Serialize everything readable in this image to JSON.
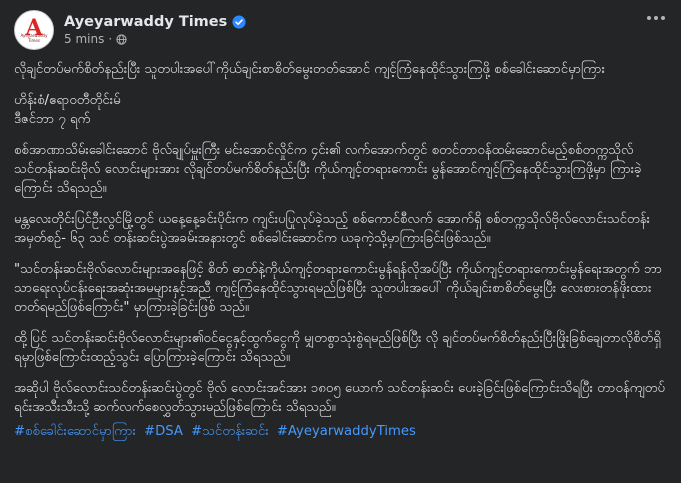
{
  "post": {
    "author": "Ayeyarwaddy Times",
    "time": "5 mins",
    "separator": "·",
    "avatar_logo": "A",
    "avatar_text": "Ayeyarwaddy Times",
    "icons": {
      "verified": "verified-badge-icon",
      "privacy": "globe-icon",
      "more": "more-options-icon"
    },
    "colors": {
      "background": "#242526",
      "text": "#e4e6eb",
      "secondary": "#b0b3b8",
      "link": "#4599ff",
      "verified": "#2d88ff"
    },
    "body": {
      "p1": "လိုချင်တပ်မက်စိတ်နည်းပြီး သူတပါးအပေါ်ကိုယ်ချင်းစာစိတ်မွေးတတ်အောင် ကျင့်ကြံနေထိုင်သွားကြဖို့ စစ်ခေါင်းဆောင်မှာကြား",
      "p2a": "ဟိန်းစံ/ဧရာဝတီတိုင်းမ်",
      "p2b": "ဒီဇင်ဘာ ၇ ရက်",
      "p3": "စစ်အာဏာသိမ်းခေါင်းဆောင် ဗိုလ်ချုပ်မှူးကြီး မင်းအောင်လှိုင်က ၄င်း၏ လက်အောက်တွင် စတင်တာဝန်ထမ်းဆောင်မည့်စစ်တက္ကသိုလ် သင်တန်းဆင်းဗိုလ် လောင်းများအား လိုချင်တပ်မက်စိတ်နည်းပြီး ကိုယ်ကျင့်တရားကောင်း မွန်အောင်ကျင့်ကြံနေထိုင်သွားကြဖို့မှာ ကြားခဲ့ကြောင်း သိရသည်။",
      "p4": "မန္တလေးတိုင်းပြင်ဦးလွင်မြို့တွင် ယနေ့နေ့ခင်းပိုင်းက ကျင်းပပြုလုပ်ခဲ့သည့် စစ်ကောင်စီလက် အောက်ရှိ စစ်တက္ကသိုလ်ဗိုလ်လောင်းသင်တန်း အမှတ်စဉ်- ၆၃ သင် တန်းဆင်းပွဲအခမ်းအနားတွင် စစ်ခေါင်းဆောင်က ယခုကဲ့သို့မှာကြားခြင်းဖြစ်သည်။",
      "p5": "\"သင်တန်းဆင်းဗိုလ်လောင်းများအနေဖြင့် စိတ် ဓာတ်နဲ့ကိုယ်ကျင့်တရားကောင်းမွန်ရန်လိုအပ်ပြီး ကိုယ်ကျင့်တရားကောင်းမွန်ရေးအတွက် ဘာ သာရေးလုပ်ငန်းရေးအဆုံးအမများနှင့်အညီ ကျင့်ကြံနေထိုင်သွားရမည်ဖြစ်ပြီး သူတပါးအပေါ် ကိုယ်ချင်းစာစိတ်မွေးပြီး လေးစားတန်ဖိုးထားတတ်ရမည်ဖြစ်ကြောင်း\" မှာကြားခဲ့ခြင်းဖြစ် သည်။",
      "p6": "ထို့ပြင် သင်တန်းဆင်းဗိုလ်လောင်းများ၏ဝင်ငွေနှင့်ထွက်ငွေကို မျှတစွာသုံးစွဲရမည်ဖြစ်ပြီး လို ချင်တပ်မက်စိတ်နည်းပြီးဖြိုးခြစ်ချေတာလိုစိတ်ရှိရမှာဖြစ်ကြောင်းထည့်သွင်း ပြောကြားခဲ့ကြောင်း သိရသည်။",
      "p7": "အဆိုပါ ဗိုလ်လောင်းသင်တန်းဆင်းပွဲတွင် ဗိုလ် လောင်းအင်အား ၁၈၀၅ ယောက် သင်တန်းဆင်း ပေးခဲ့ခြင်းဖြစ်ကြောင်းသိရပြီး တာဝန်ကျတပ် ရင်းအသီးသီးသို့ ဆက်လက်စေလွှတ်သွားမည်ဖြစ်ကြောင်း သိရသည်။"
    },
    "hashtags": [
      "#စစ်ခေါင်းဆောင်မှာကြား",
      "#DSA",
      "#သင်တန်းဆင်း",
      "#AyeyarwaddyTimes"
    ]
  }
}
